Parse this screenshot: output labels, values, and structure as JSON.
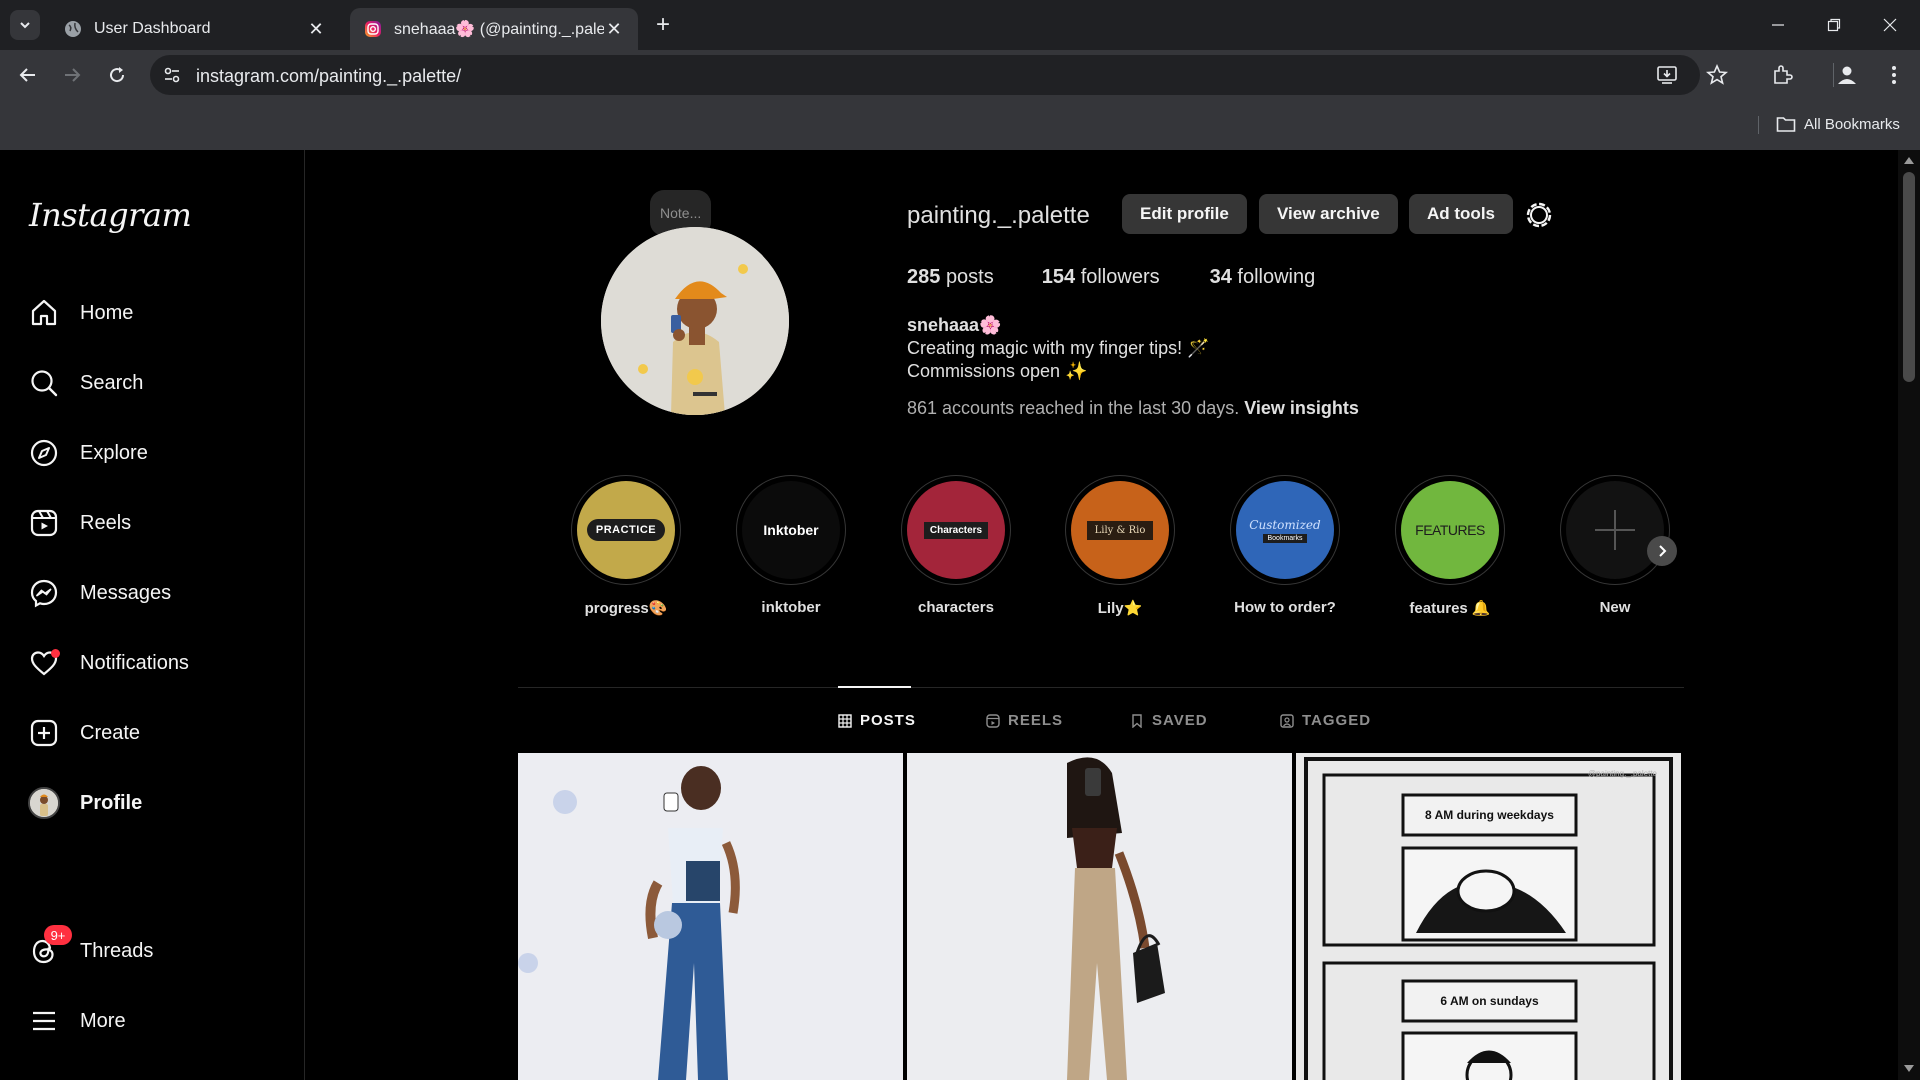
{
  "browser": {
    "tabs": [
      {
        "title": "User Dashboard",
        "active": false
      },
      {
        "title": "snehaaa🌸 (@painting._.palette",
        "active": true
      }
    ],
    "url": "instagram.com/painting._.palette/",
    "bookmarks_label": "All Bookmarks"
  },
  "sidebar": {
    "logo": "Instagram",
    "items": [
      {
        "label": "Home",
        "icon": "home-icon"
      },
      {
        "label": "Search",
        "icon": "search-icon"
      },
      {
        "label": "Explore",
        "icon": "compass-icon"
      },
      {
        "label": "Reels",
        "icon": "reels-icon"
      },
      {
        "label": "Messages",
        "icon": "messenger-icon"
      },
      {
        "label": "Notifications",
        "icon": "heart-icon"
      },
      {
        "label": "Create",
        "icon": "plus-square-icon"
      },
      {
        "label": "Profile",
        "icon": "avatar"
      }
    ],
    "threads": {
      "label": "Threads",
      "badge": "9+"
    },
    "more": "More"
  },
  "profile": {
    "note": "Note...",
    "username": "painting._.palette",
    "buttons": {
      "edit": "Edit profile",
      "archive": "View archive",
      "ad_tools": "Ad tools"
    },
    "stats": {
      "posts_n": "285",
      "posts_label": "posts",
      "followers_n": "154",
      "followers_label": "followers",
      "following_n": "34",
      "following_label": "following"
    },
    "display_name": "snehaaa🌸",
    "bio_line1": "Creating magic with my finger tips! 🪄",
    "bio_line2": "Commissions open ✨",
    "reach_text": "861 accounts reached in the last 30 days.",
    "reach_link": "View insights"
  },
  "highlights": [
    {
      "label": "progress🎨",
      "cover_text": "PRACTICE",
      "color": "#c2a94a"
    },
    {
      "label": "inktober",
      "cover_text": "Inktober",
      "color": "#0b0b0b"
    },
    {
      "label": "characters",
      "cover_text": "Characters",
      "color": "#a3253a"
    },
    {
      "label": "Lily⭐",
      "cover_text": "Lily & Rio",
      "color": "#c7621a"
    },
    {
      "label": "How to order?",
      "cover_text": "Customized",
      "cover_sub": "Bookmarks",
      "color": "#2f66b8"
    },
    {
      "label": "features 🔔",
      "cover_text": "FEATURES",
      "color": "#71b73e"
    },
    {
      "label": "New",
      "cover_text": "+",
      "color": "#121212"
    }
  ],
  "tabs": [
    "POSTS",
    "REELS",
    "SAVED",
    "TAGGED"
  ],
  "posts": [
    {
      "kind": "illustration-blue-jeans"
    },
    {
      "kind": "illustration-beige-pants"
    },
    {
      "kind": "comic",
      "panel1": "8 AM during weekdays",
      "panel2": "6 AM on sundays",
      "watermark": "@painting._.palette"
    }
  ],
  "colors": {
    "background": "#000000",
    "surface": "#363636",
    "text": "#f5f5f5",
    "muted": "#8e8e8e",
    "notification": "#ff3040"
  }
}
